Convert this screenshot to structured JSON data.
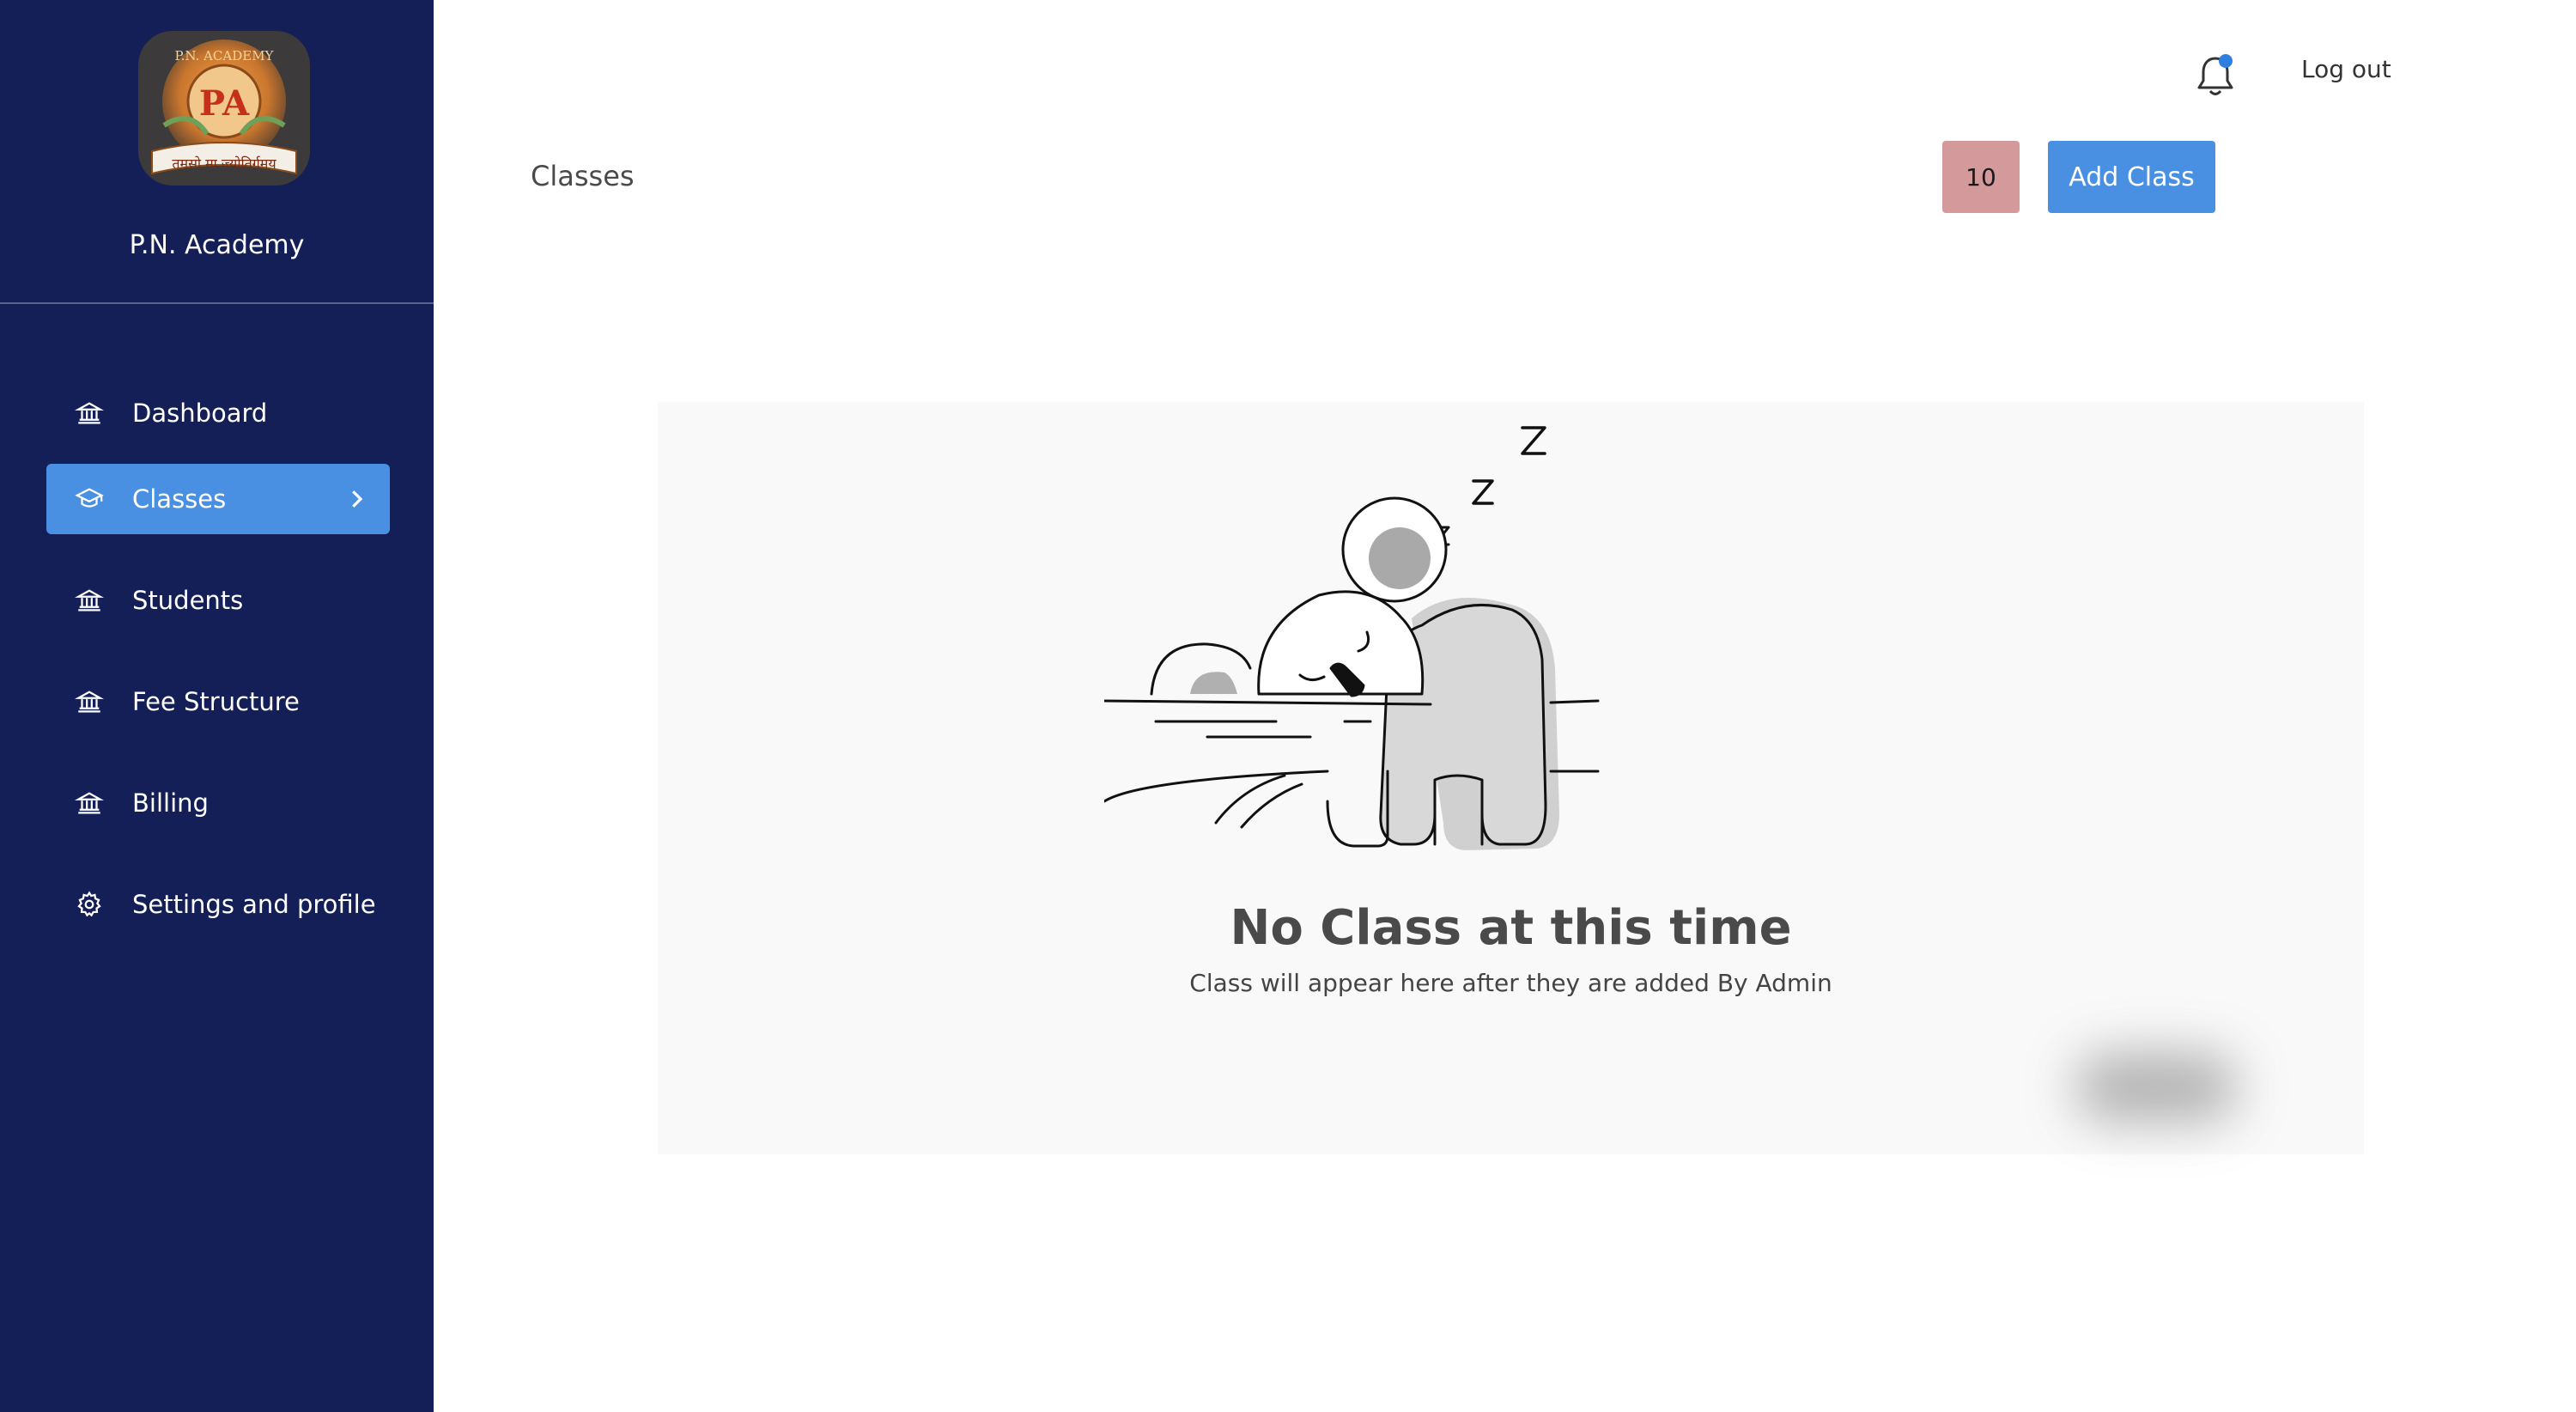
{
  "sidebar": {
    "brand_name": "P.N. Academy",
    "logo": {
      "text_top": "P.N. ACADEMY",
      "initials": "PA",
      "text_bottom": "तमसो मा ज्योतिर्गमय"
    },
    "items": [
      {
        "label": "Dashboard",
        "icon": "bank-icon"
      },
      {
        "label": "Classes",
        "icon": "graduation-cap-icon",
        "active": true
      },
      {
        "label": "Students",
        "icon": "bank-icon"
      },
      {
        "label": "Fee Structure",
        "icon": "bank-icon"
      },
      {
        "label": "Billing",
        "icon": "bank-icon"
      },
      {
        "label": "Settings and profile",
        "icon": "gear-icon"
      }
    ]
  },
  "header": {
    "logout_label": "Log out",
    "notification_icon": "bell-icon"
  },
  "main": {
    "title": "Classes",
    "count": "10",
    "add_button_label": "Add Class"
  },
  "empty_state": {
    "title": "No Class at this time",
    "subtitle": "Class will appear here after they are added By Admin",
    "illustration": "sleeping-koala"
  },
  "colors": {
    "sidebar_bg": "#141f57",
    "accent": "#4a90e2",
    "badge_bg": "#d4999a",
    "panel_bg": "#faf9f9"
  }
}
